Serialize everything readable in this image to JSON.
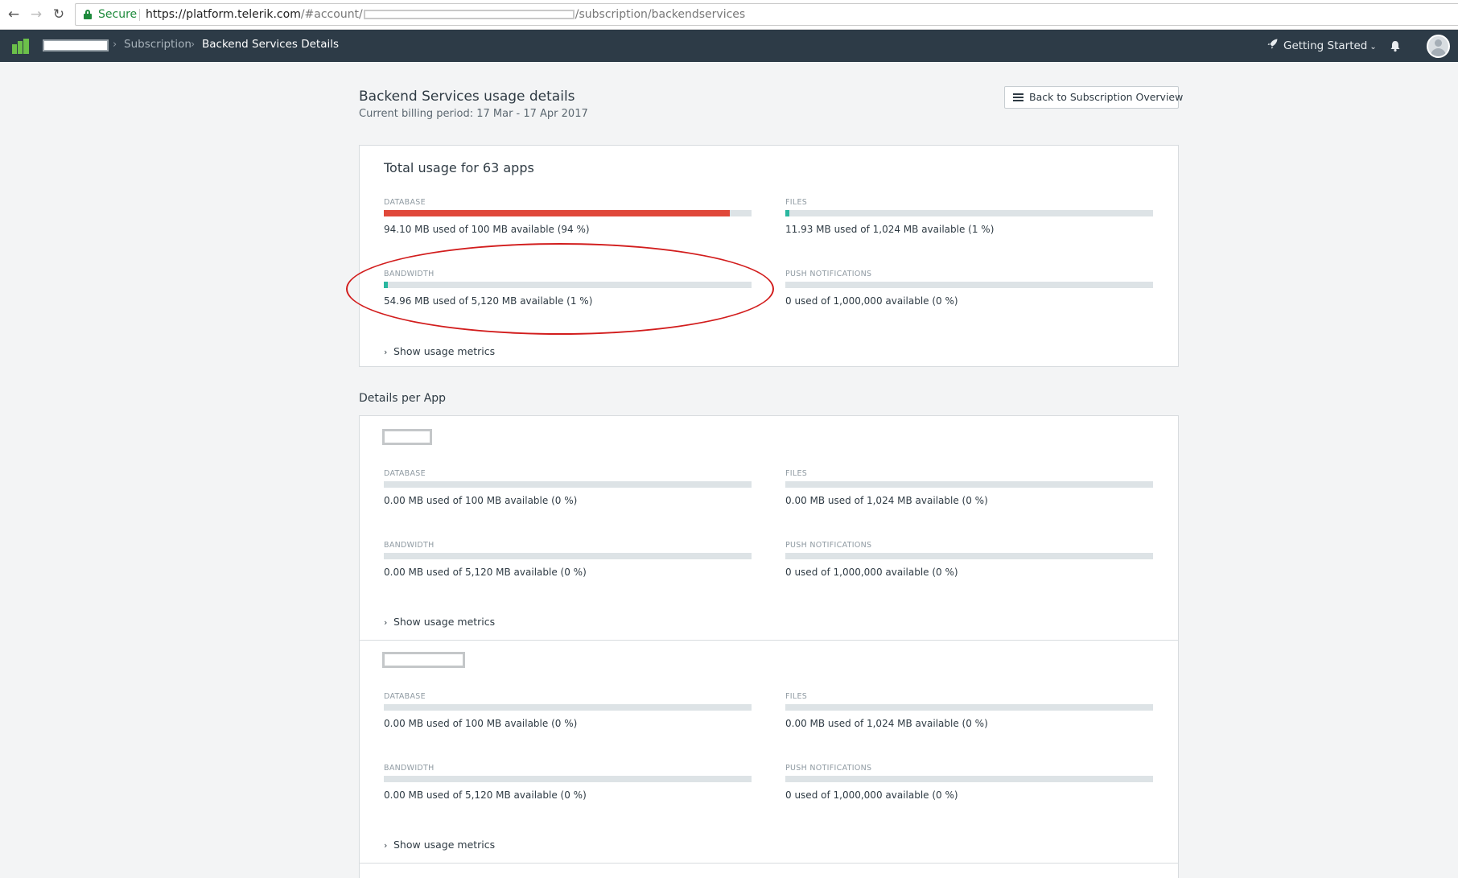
{
  "browser": {
    "secure_label": "Secure",
    "url_prefix": "https://platform.telerik.com",
    "url_mid": "/#account/",
    "url_suffix": "/subscription/backendservices"
  },
  "header": {
    "breadcrumb": {
      "subscription": "Subscription",
      "current": "Backend Services Details"
    },
    "getting_started": "Getting Started"
  },
  "page": {
    "title": "Backend Services usage details",
    "billing_period": "Current billing period: 17 Mar - 17 Apr 2017",
    "back_button": "Back to Subscription Overview",
    "details_heading": "Details per App"
  },
  "total": {
    "title": "Total usage for 63 apps",
    "database": {
      "label": "DATABASE",
      "text": "94.10 MB used of 100 MB available (94 %)",
      "percent": 94
    },
    "files": {
      "label": "FILES",
      "text": "11.93 MB used of 1,024 MB available (1 %)",
      "percent": 1
    },
    "bandwidth": {
      "label": "BANDWIDTH",
      "text": "54.96 MB used of 5,120 MB available (1 %)",
      "percent": 1
    },
    "push": {
      "label": "PUSH NOTIFICATIONS",
      "text": "0 used of 1,000,000 available (0 %)",
      "percent": 0
    },
    "show_metrics": "Show usage metrics"
  },
  "apps": [
    {
      "database": {
        "label": "DATABASE",
        "text": "0.00 MB used of 100 MB available (0 %)",
        "percent": 0
      },
      "files": {
        "label": "FILES",
        "text": "0.00 MB used of 1,024 MB available (0 %)",
        "percent": 0
      },
      "bandwidth": {
        "label": "BANDWIDTH",
        "text": "0.00 MB used of 5,120 MB available (0 %)",
        "percent": 0
      },
      "push": {
        "label": "PUSH NOTIFICATIONS",
        "text": "0 used of 1,000,000 available (0 %)",
        "percent": 0
      },
      "show_metrics": "Show usage metrics"
    },
    {
      "database": {
        "label": "DATABASE",
        "text": "0.00 MB used of 100 MB available (0 %)",
        "percent": 0
      },
      "files": {
        "label": "FILES",
        "text": "0.00 MB used of 1,024 MB available (0 %)",
        "percent": 0
      },
      "bandwidth": {
        "label": "BANDWIDTH",
        "text": "0.00 MB used of 5,120 MB available (0 %)",
        "percent": 0
      },
      "push": {
        "label": "PUSH NOTIFICATIONS",
        "text": "0 used of 1,000,000 available (0 %)",
        "percent": 0
      },
      "show_metrics": "Show usage metrics"
    }
  ],
  "colors": {
    "header_bg": "#2d3b47",
    "accent_green": "#6cc04a",
    "bar_normal": "#2bb7a0",
    "bar_danger": "#e0483a",
    "annotation": "#d21d1d"
  }
}
